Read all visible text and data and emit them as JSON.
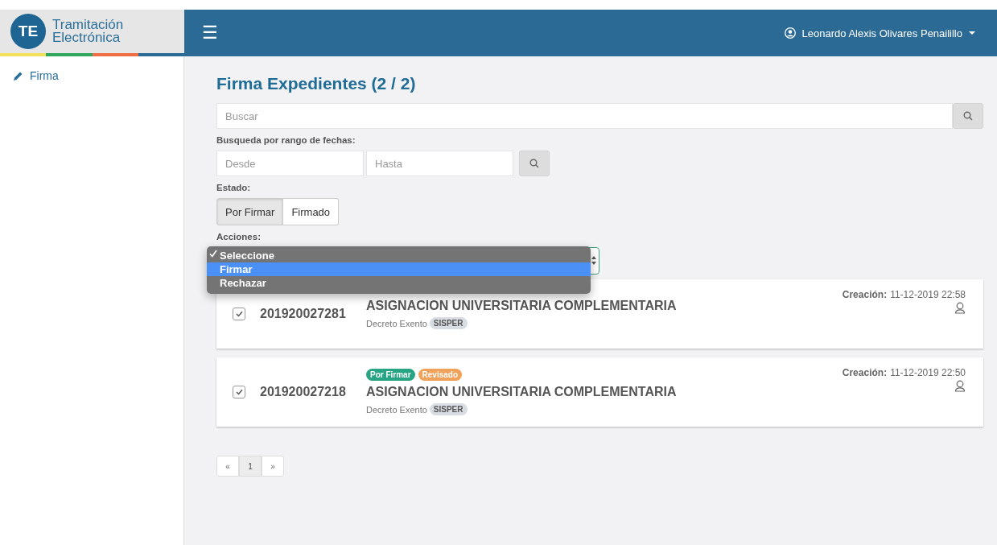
{
  "brand": {
    "logo": "TE",
    "name_line1": "Tramitación",
    "name_line2": "Electrónica"
  },
  "header": {
    "menu_icon": "☰",
    "user": "Leonardo Alexis Olivares Penailillo"
  },
  "sidebar": {
    "items": [
      {
        "label": "Firma",
        "selected": false
      }
    ]
  },
  "page": {
    "title": "Firma Expedientes (2 / 2)",
    "search": {
      "placeholder": "Buscar"
    },
    "date_label": "Busqueda por rango de fechas:",
    "date_from": {
      "placeholder": "Desde"
    },
    "date_to": {
      "placeholder": "Hasta"
    },
    "state_label": "Estado:",
    "state_options": [
      {
        "label": "Por Firmar",
        "selected": true
      },
      {
        "label": "Firmado",
        "selected": false
      }
    ],
    "actions_label": "Acciones:",
    "actions_menu": [
      {
        "label": "Seleccione",
        "checked": true,
        "highlighted": false
      },
      {
        "label": "Firmar",
        "checked": false,
        "highlighted": true
      },
      {
        "label": "Rechazar",
        "checked": false,
        "highlighted": false
      }
    ]
  },
  "records": [
    {
      "checked": true,
      "number": "201920027281",
      "title": "ASIGNACION UNIVERSITARIA COMPLEMENTARIA",
      "type": "Decreto Exento",
      "system": "SISPER",
      "created_label": "Creación:",
      "created": "11-12-2019 22:58"
    },
    {
      "checked": true,
      "number": "201920027218",
      "tags": [
        {
          "label": "Por Firmar",
          "color": "#26a483"
        },
        {
          "label": "Revisado",
          "color": "#f0a15a"
        }
      ],
      "title": "ASIGNACION UNIVERSITARIA COMPLEMENTARIA",
      "type": "Decreto Exento",
      "system": "SISPER",
      "created_label": "Creación:",
      "created": "11-12-2019 22:50"
    }
  ],
  "pagination": {
    "prev": "«",
    "pages": [
      {
        "label": "1",
        "selected": true
      }
    ],
    "next": "»"
  }
}
